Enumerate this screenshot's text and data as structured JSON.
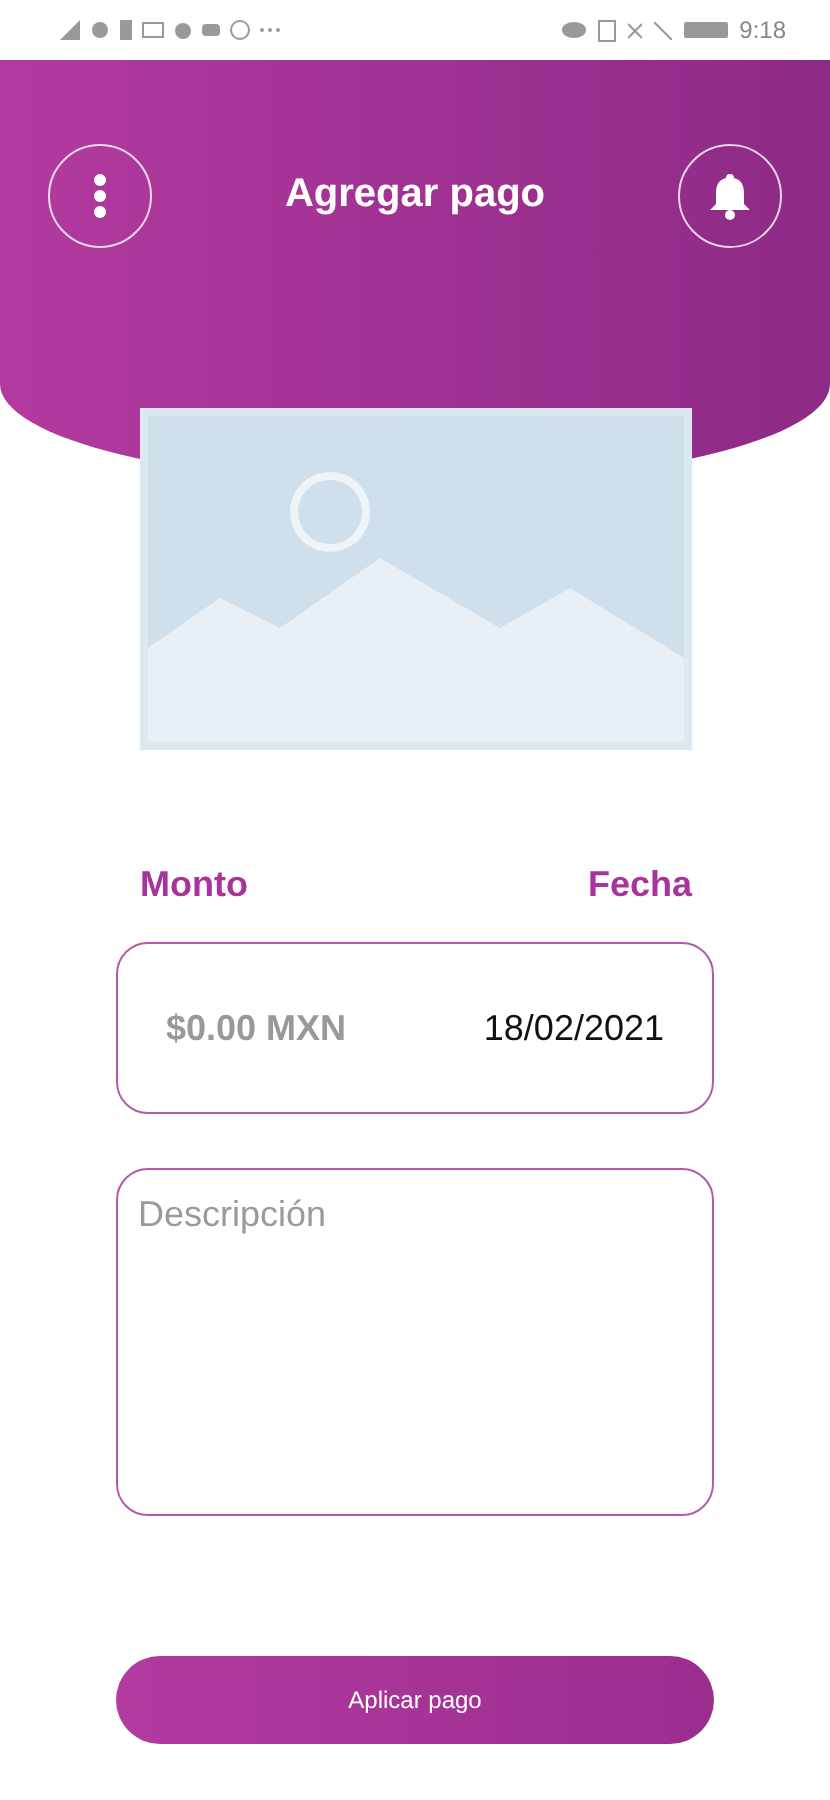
{
  "status_bar": {
    "time": "9:18"
  },
  "header": {
    "title": "Agregar pago"
  },
  "form": {
    "amount_label": "Monto",
    "date_label": "Fecha",
    "amount": {
      "placeholder": "$0.00 MXN"
    },
    "date": {
      "value": "18/02/2021"
    },
    "description": {
      "placeholder": "Descripción"
    }
  },
  "buttons": [
    "Aplicar pago"
  ]
}
